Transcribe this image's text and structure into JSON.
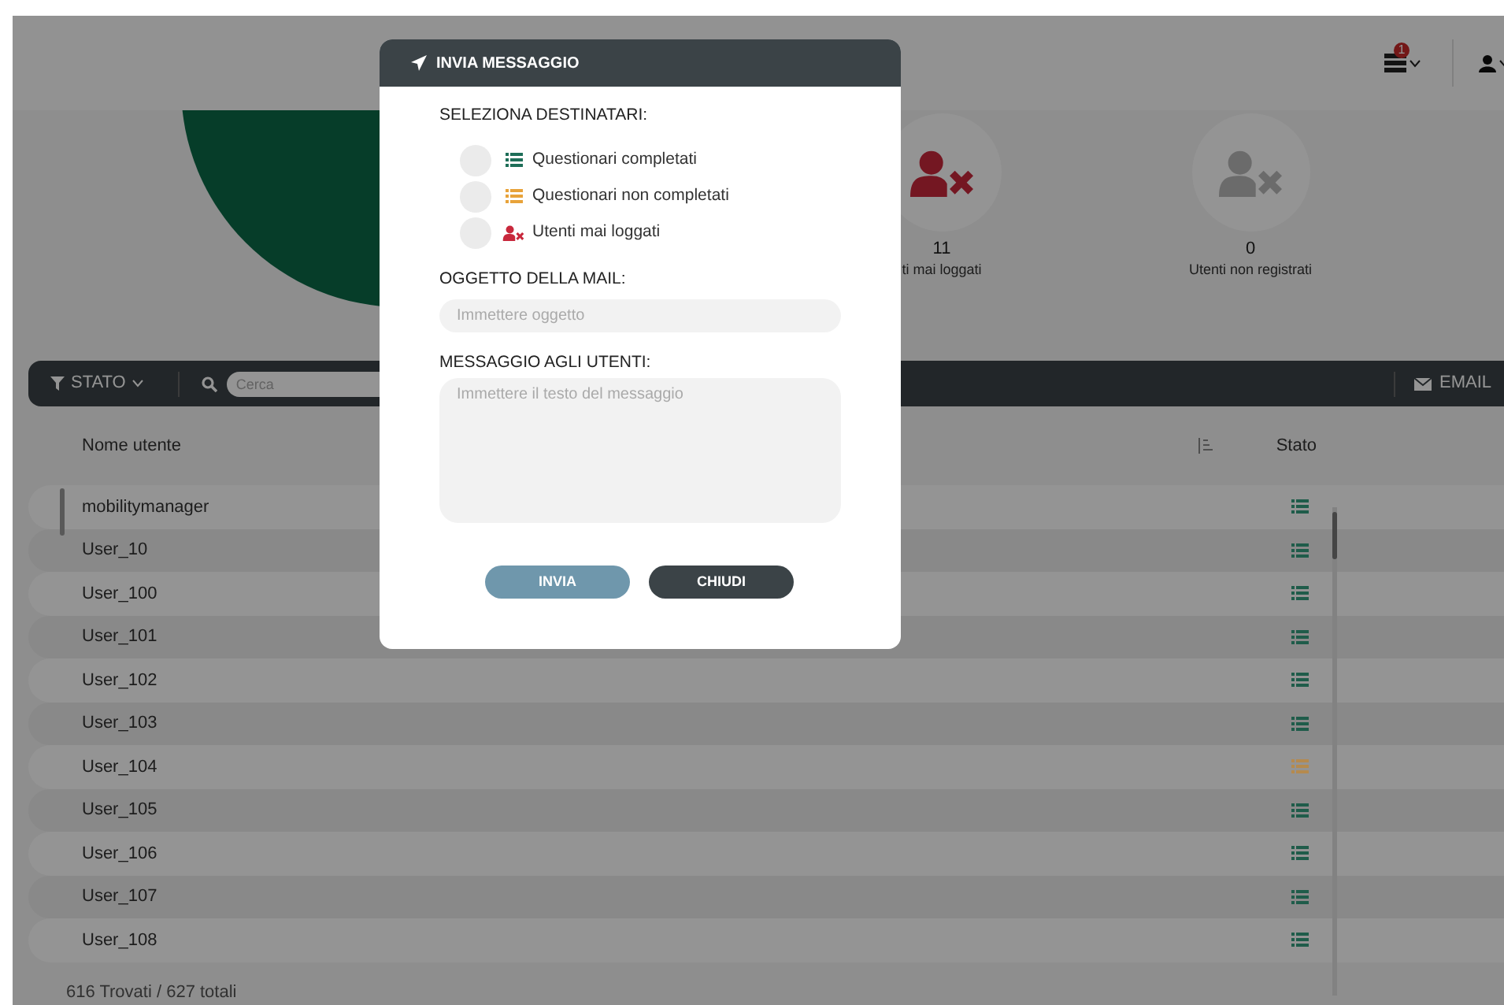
{
  "header": {
    "notifications": {
      "badge": "1"
    }
  },
  "stats": [
    {
      "kind": "never_logged",
      "value": "11",
      "label": "ti mai loggati"
    },
    {
      "kind": "unregistered",
      "value": "0",
      "label": "Utenti non registrati"
    }
  ],
  "toolbar": {
    "filter": "STATO",
    "search": {
      "placeholder": "Cerca"
    },
    "email": "EMAIL"
  },
  "table": {
    "columns": [
      "Nome utente",
      "Stato"
    ],
    "rows": [
      {
        "name": "mobilitymanager",
        "color": "#1f5c4a"
      },
      {
        "name": "User_10",
        "color": "#1f5c4a"
      },
      {
        "name": "User_100",
        "color": "#1f5c4a"
      },
      {
        "name": "User_101",
        "color": "#1f5c4a"
      },
      {
        "name": "User_102",
        "color": "#1f5c4a"
      },
      {
        "name": "User_103",
        "color": "#1f5c4a"
      },
      {
        "name": "User_104",
        "color": "#b58a4e"
      },
      {
        "name": "User_105",
        "color": "#1f5c4a"
      },
      {
        "name": "User_106",
        "color": "#1f5c4a"
      },
      {
        "name": "User_107",
        "color": "#1f5c4a"
      },
      {
        "name": "User_108",
        "color": "#1f5c4a"
      }
    ]
  },
  "footer": "616 Trovati / 627 totali",
  "dialog": {
    "title": "INVIA MESSAGGIO",
    "recipients_label": "SELEZIONA DESTINATARI:",
    "options": [
      {
        "kind": "completed",
        "label": "Questionari completati",
        "selected": false
      },
      {
        "kind": "incomplete",
        "label": "Questionari non completati",
        "selected": false
      },
      {
        "kind": "never_logged",
        "label": "Utenti mai loggati",
        "selected": false
      }
    ],
    "subject_label": "OGGETTO DELLA MAIL:",
    "subject": {
      "placeholder": "Immettere oggetto"
    },
    "message_label": "MESSAGGIO AGLI UTENTI:",
    "message": {
      "placeholder": "Immettere il testo del messaggio"
    },
    "buttons": [
      {
        "kind": "primary",
        "label": "INVIA"
      },
      {
        "kind": "secondary",
        "label": "CHIUDI"
      }
    ]
  }
}
